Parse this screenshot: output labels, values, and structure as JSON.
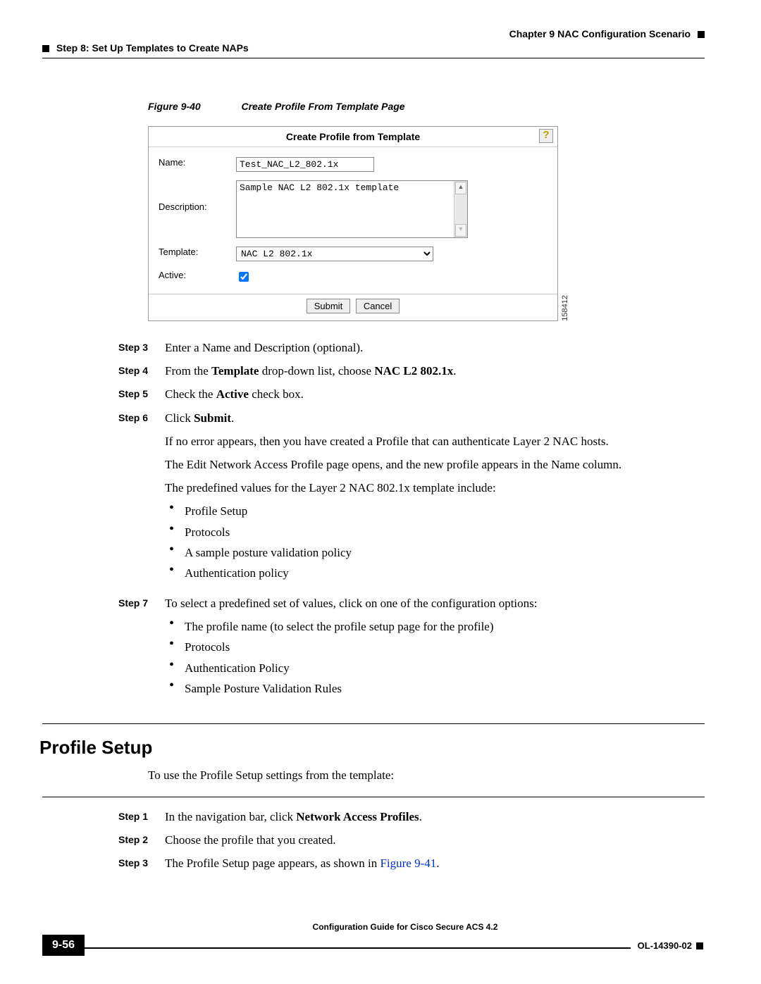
{
  "header": {
    "chapter": "Chapter 9    NAC Configuration Scenario",
    "step": "Step 8: Set Up Templates to Create NAPs"
  },
  "figure": {
    "label": "Figure 9-40",
    "title": "Create Profile From Template Page",
    "panel_title": "Create Profile from Template",
    "help_icon": "?",
    "name_label": "Name:",
    "name_value": "Test_NAC_L2_802.1x",
    "desc_label": "Description:",
    "desc_value": "Sample NAC L2 802.1x template",
    "template_label": "Template:",
    "template_value": "NAC L2 802.1x",
    "active_label": "Active:",
    "submit": "Submit",
    "cancel": "Cancel",
    "id": "158412"
  },
  "steps": {
    "s3_label": "Step 3",
    "s3_text": "Enter a Name and Description (optional).",
    "s4_label": "Step 4",
    "s4_prefix": "From the ",
    "s4_b1": "Template",
    "s4_mid": " drop-down list, choose ",
    "s4_b2": "NAC L2 802.1x",
    "s4_suffix": ".",
    "s5_label": "Step 5",
    "s5_prefix": "Check the ",
    "s5_b1": "Active",
    "s5_suffix": " check box.",
    "s6_label": "Step 6",
    "s6_prefix": "Click ",
    "s6_b1": "Submit",
    "s6_suffix": ".",
    "s6_p1": "If no error appears, then you have created a Profile that can authenticate Layer 2 NAC hosts.",
    "s6_p2": "The Edit Network Access Profile page opens, and the new profile appears in the Name column.",
    "s6_p3": "The predefined values for the Layer 2 NAC 802.1x template include:",
    "s6_li1": "Profile Setup",
    "s6_li2": "Protocols",
    "s6_li3": "A sample posture validation policy",
    "s6_li4": "Authentication policy",
    "s7_label": "Step 7",
    "s7_text": "To select a predefined set of values, click on one of the configuration options:",
    "s7_li1": "The profile name (to select the profile setup page for the profile)",
    "s7_li2": "Protocols",
    "s7_li3": "Authentication Policy",
    "s7_li4": "Sample Posture Validation Rules"
  },
  "section2": {
    "heading": "Profile Setup",
    "intro": "To use the Profile Setup settings from the template:",
    "s1_label": "Step 1",
    "s1_prefix": "In the navigation bar, click ",
    "s1_b1": "Network Access Profiles",
    "s1_suffix": ".",
    "s2_label": "Step 2",
    "s2_text": "Choose the profile that you created.",
    "s3_label": "Step 3",
    "s3_prefix": "The Profile Setup page appears, as shown in ",
    "s3_link": "Figure 9-41",
    "s3_suffix": "."
  },
  "footer": {
    "guide": "Configuration Guide for Cisco Secure ACS 4.2",
    "page": "9-56",
    "doc": "OL-14390-02"
  }
}
